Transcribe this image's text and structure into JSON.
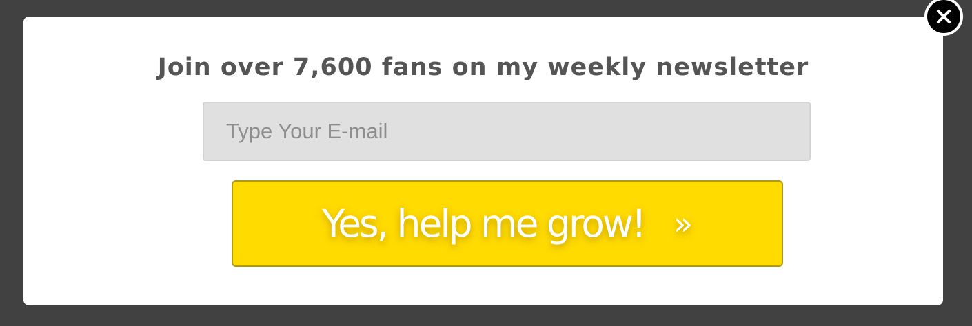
{
  "popup": {
    "headline": "Join over 7,600 fans on my weekly newsletter",
    "email_placeholder": "Type Your E-mail",
    "email_value": "",
    "submit_label": "Yes, help me grow!",
    "submit_arrow": "»",
    "close_icon": "close-icon"
  },
  "colors": {
    "backdrop": "#414141",
    "modal_bg": "#ffffff",
    "headline_text": "#555555",
    "input_bg": "#e0e0e0",
    "button_bg": "#ffdb00",
    "button_border": "#b09a14",
    "button_text": "#ffffff",
    "close_bg": "#000000"
  }
}
